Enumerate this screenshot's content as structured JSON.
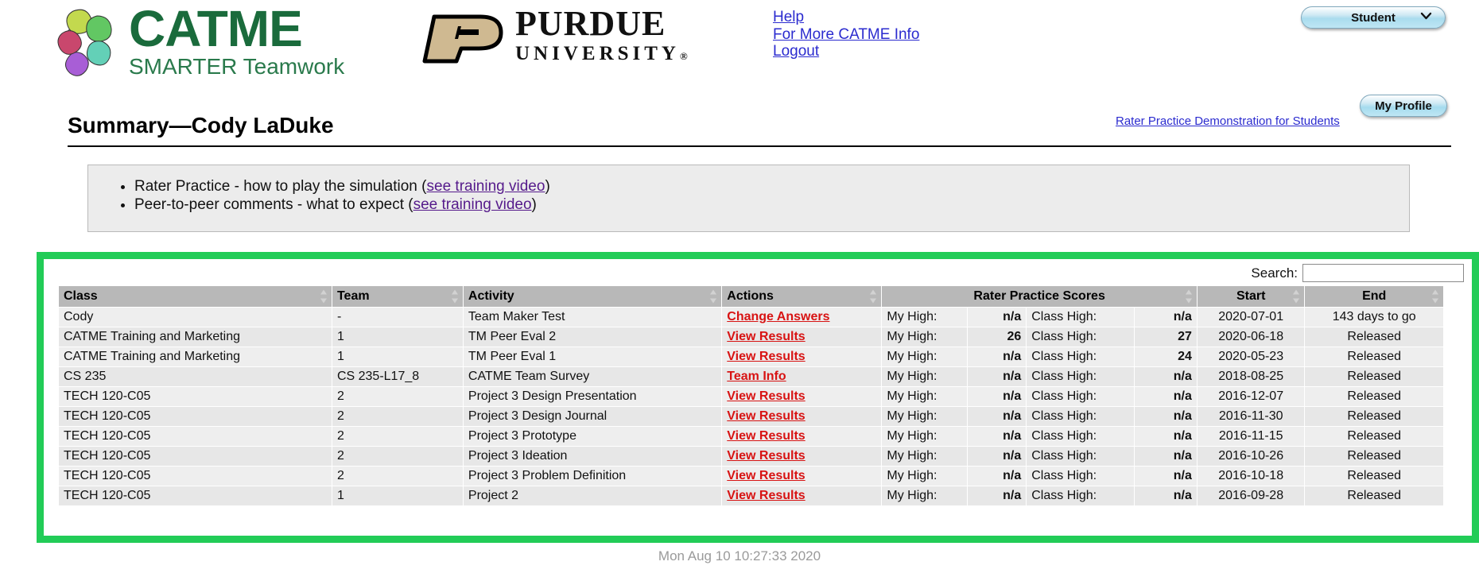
{
  "brand": {
    "catme_name": "CATME",
    "catme_tagline": "SMARTER Teamwork",
    "purdue_name": "PURDUE",
    "purdue_sub": "UNIVERSITY",
    "catme_green": "#1a6b3c",
    "purdue_gold": "#cfb991"
  },
  "nav": {
    "help": "Help",
    "more_info": "For More CATME Info",
    "logout": "Logout"
  },
  "role": {
    "selected": "Student",
    "chevron": "⌄"
  },
  "profile": {
    "label": "My Profile"
  },
  "page": {
    "title": "Summary—Cody LaDuke",
    "demo_link": "Rater Practice Demonstration for Students"
  },
  "info": {
    "items": [
      {
        "pre": "Rater Practice - how to play the simulation (",
        "link": "see training video",
        "post": ")"
      },
      {
        "pre": "Peer-to-peer comments - what to expect (",
        "link": "see training video",
        "post": ")"
      }
    ]
  },
  "search": {
    "label": "Search:",
    "value": "",
    "placeholder": ""
  },
  "table": {
    "headers": {
      "class": "Class",
      "team": "Team",
      "activity": "Activity",
      "actions": "Actions",
      "scores": "Rater Practice Scores",
      "start": "Start",
      "end": "End"
    },
    "score_labels": {
      "my_high": "My High:",
      "class_high": "Class High:"
    },
    "rows": [
      {
        "class": "Cody",
        "team": "-",
        "activity": "Team Maker Test",
        "action": "Change Answers",
        "my_high": "n/a",
        "class_high": "n/a",
        "start": "2020-07-01",
        "end": "143 days to go"
      },
      {
        "class": "CATME Training and Marketing",
        "team": "1",
        "activity": "TM Peer Eval 2",
        "action": "View Results",
        "my_high": "26",
        "class_high": "27",
        "start": "2020-06-18",
        "end": "Released"
      },
      {
        "class": "CATME Training and Marketing",
        "team": "1",
        "activity": "TM Peer Eval 1",
        "action": "View Results",
        "my_high": "n/a",
        "class_high": "24",
        "start": "2020-05-23",
        "end": "Released"
      },
      {
        "class": "CS 235",
        "team": "CS 235-L17_8",
        "activity": "CATME Team Survey",
        "action": "Team Info",
        "my_high": "n/a",
        "class_high": "n/a",
        "start": "2018-08-25",
        "end": "Released"
      },
      {
        "class": "TECH 120-C05",
        "team": "2",
        "activity": "Project 3 Design Presentation",
        "action": "View Results",
        "my_high": "n/a",
        "class_high": "n/a",
        "start": "2016-12-07",
        "end": "Released"
      },
      {
        "class": "TECH 120-C05",
        "team": "2",
        "activity": "Project 3 Design Journal",
        "action": "View Results",
        "my_high": "n/a",
        "class_high": "n/a",
        "start": "2016-11-30",
        "end": "Released"
      },
      {
        "class": "TECH 120-C05",
        "team": "2",
        "activity": "Project 3 Prototype",
        "action": "View Results",
        "my_high": "n/a",
        "class_high": "n/a",
        "start": "2016-11-15",
        "end": "Released"
      },
      {
        "class": "TECH 120-C05",
        "team": "2",
        "activity": "Project 3 Ideation",
        "action": "View Results",
        "my_high": "n/a",
        "class_high": "n/a",
        "start": "2016-10-26",
        "end": "Released"
      },
      {
        "class": "TECH 120-C05",
        "team": "2",
        "activity": "Project 3 Problem Definition",
        "action": "View Results",
        "my_high": "n/a",
        "class_high": "n/a",
        "start": "2016-10-18",
        "end": "Released"
      },
      {
        "class": "TECH 120-C05",
        "team": "1",
        "activity": "Project 2",
        "action": "View Results",
        "my_high": "n/a",
        "class_high": "n/a",
        "start": "2016-09-28",
        "end": "Released"
      }
    ]
  },
  "footer": {
    "timestamp": "Mon Aug 10 10:27:33 2020"
  },
  "highlight": {
    "border_color": "#22cc57"
  }
}
